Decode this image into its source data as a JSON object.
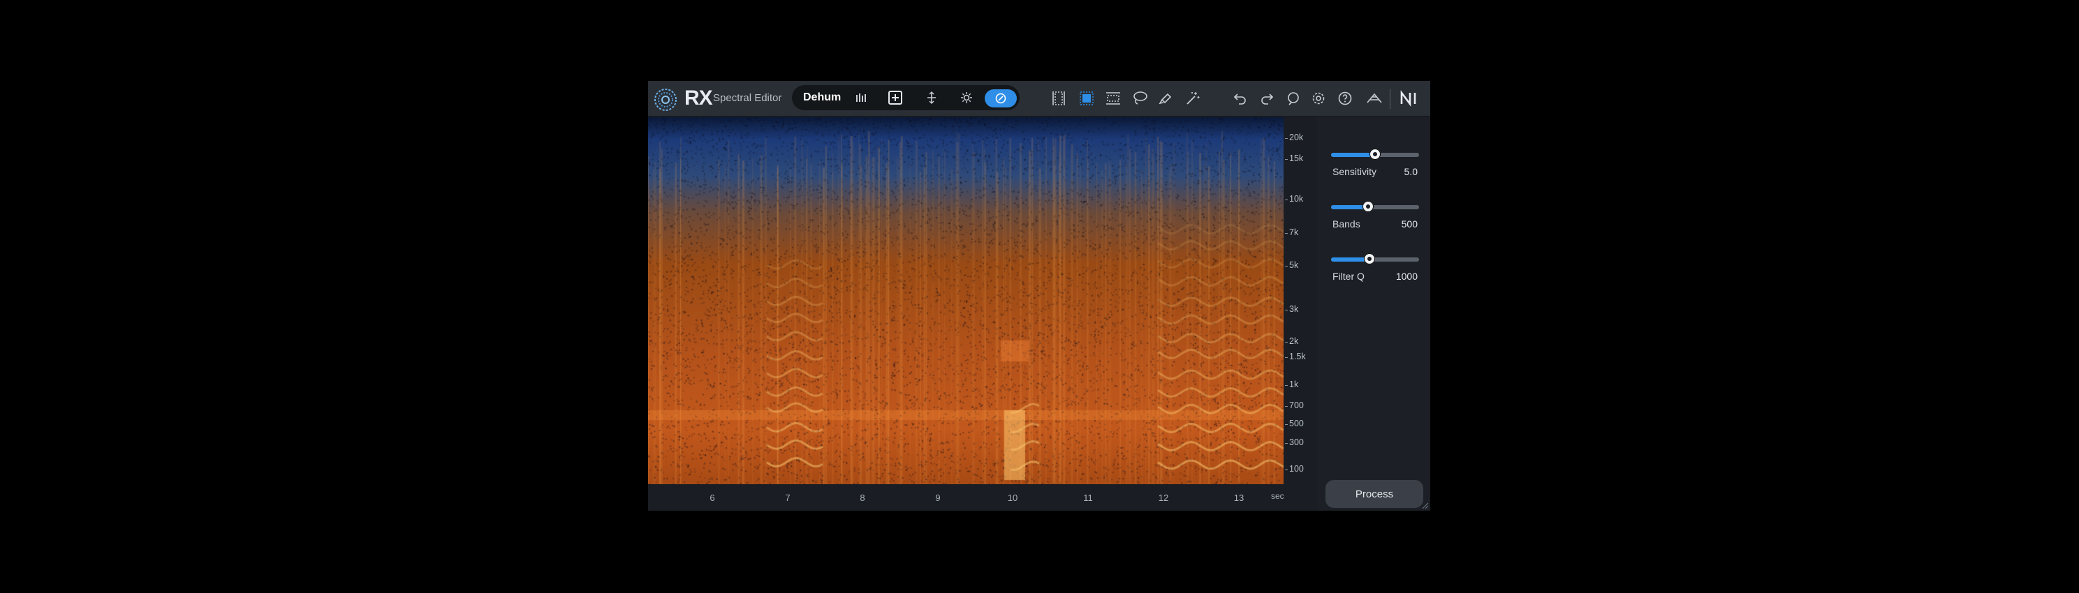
{
  "app": {
    "brand": "RX",
    "product": "Spectral Editor"
  },
  "module": {
    "name": "Dehum",
    "toggle_on": true
  },
  "toolbar": {
    "icons": [
      "bars-icon",
      "add-box-icon",
      "crosshair-icon",
      "sun-icon",
      "power-toggle-icon",
      "time-select-icon",
      "rect-select-icon",
      "freq-select-icon",
      "lasso-icon",
      "brush-icon",
      "magic-wand-icon",
      "undo-icon",
      "redo-icon",
      "history-icon",
      "settings-icon",
      "help-icon",
      "broadcast-icon",
      "ni-logo-icon"
    ],
    "accent": "#2f8ee8"
  },
  "freq_scale": [
    "20k",
    "15k",
    "10k",
    "7k",
    "5k",
    "3k",
    "2k",
    "1.5k",
    "1k",
    "700",
    "500",
    "300",
    "100"
  ],
  "time_axis": {
    "ticks": [
      "6",
      "7",
      "8",
      "9",
      "10",
      "11",
      "12",
      "13"
    ],
    "unit": "sec"
  },
  "panel": {
    "sliders": [
      {
        "label": "Sensitivity",
        "value": "5.0",
        "level": 0.5
      },
      {
        "label": "Bands",
        "value": "500",
        "level": 0.42
      },
      {
        "label": "Filter Q",
        "value": "1000",
        "level": 0.44
      }
    ],
    "process_label": "Process"
  }
}
